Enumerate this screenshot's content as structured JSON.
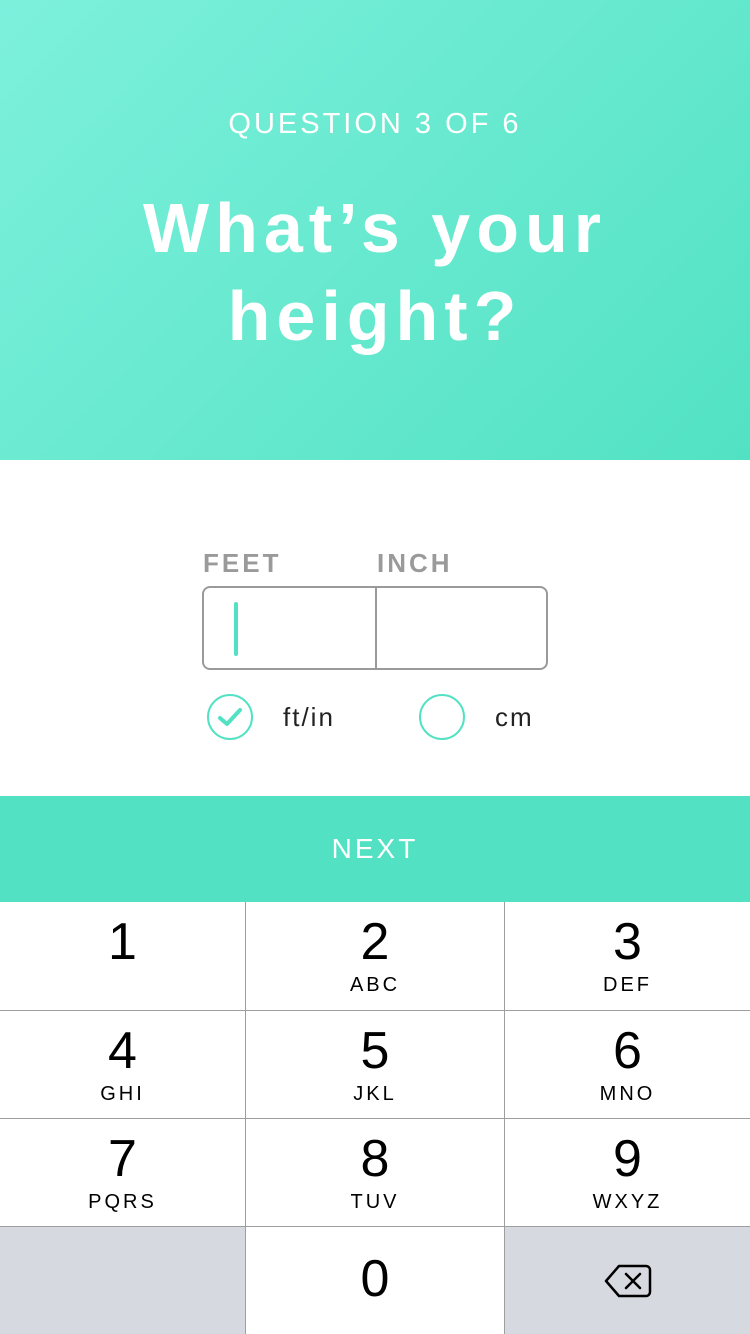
{
  "header": {
    "question_label": "QUESTION 3 OF 6",
    "title": "What’s your height?"
  },
  "form": {
    "feet_label": "FEET",
    "inch_label": "INCH",
    "units": [
      {
        "label": "ft/in",
        "selected": true
      },
      {
        "label": "cm",
        "selected": false
      }
    ]
  },
  "next_button": {
    "label": "NEXT"
  },
  "keypad": {
    "keys": [
      {
        "num": "1",
        "letters": ""
      },
      {
        "num": "2",
        "letters": "ABC"
      },
      {
        "num": "3",
        "letters": "DEF"
      },
      {
        "num": "4",
        "letters": "GHI"
      },
      {
        "num": "5",
        "letters": "JKL"
      },
      {
        "num": "6",
        "letters": "MNO"
      },
      {
        "num": "7",
        "letters": "PQRS"
      },
      {
        "num": "8",
        "letters": "TUV"
      },
      {
        "num": "9",
        "letters": "WXYZ"
      },
      {
        "num": "0",
        "letters": ""
      }
    ]
  },
  "colors": {
    "accent": "#52e2c3",
    "accent_light": "#7df0dc",
    "label_gray": "#9a9a9a",
    "key_gray": "#d6d9df"
  },
  "icons": {
    "check": "check-icon",
    "backspace": "backspace-icon"
  }
}
